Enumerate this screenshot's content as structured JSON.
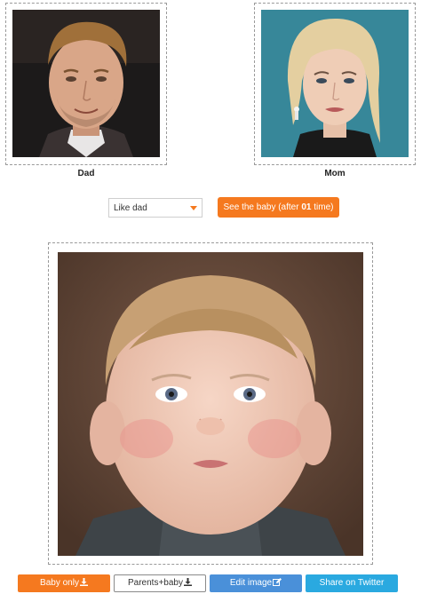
{
  "parents": {
    "dad": {
      "label": "Dad"
    },
    "mom": {
      "label": "Mom"
    }
  },
  "controls": {
    "resemblance_select": {
      "selected": "Like dad"
    },
    "see_button": {
      "label_before": "See the baby (after ",
      "count": "01",
      "label_after": " time)"
    }
  },
  "actions": {
    "baby_only": "Baby only",
    "parents_baby": "Parents+baby",
    "edit_image": "Edit image",
    "share_twitter": "Share on Twitter"
  },
  "icons": {
    "download": "download-icon",
    "edit": "edit-icon",
    "dropdown": "caret-down-icon"
  },
  "colors": {
    "accent_orange": "#f5791f",
    "edit_blue": "#4a90d9",
    "twitter_blue": "#2aa9e0"
  }
}
